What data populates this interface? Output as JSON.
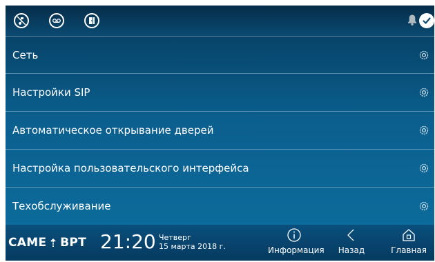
{
  "status_bar": {
    "icons": [
      {
        "name": "mute-ringtone-icon"
      },
      {
        "name": "voicemail-icon"
      },
      {
        "name": "door-status-icon"
      }
    ],
    "bell_icon": "bell-icon",
    "check_icon": "check-icon"
  },
  "menu": {
    "items": [
      {
        "label": "Сеть"
      },
      {
        "label": "Настройки SIP"
      },
      {
        "label": "Автоматическое открывание дверей"
      },
      {
        "label": "Настройка пользовательского интерфейса"
      },
      {
        "label": "Техобслуживание"
      }
    ]
  },
  "footer": {
    "brand_left": "CAME",
    "brand_right": "BPT",
    "time": "21:20",
    "day": "Четверг",
    "date": "15 марта 2018 г.",
    "buttons": {
      "info": "Информация",
      "back": "Назад",
      "home": "Главная"
    }
  },
  "colors": {
    "background_top": "#063a5c",
    "background_bottom": "#0d6f9f",
    "text": "#ffffff"
  }
}
